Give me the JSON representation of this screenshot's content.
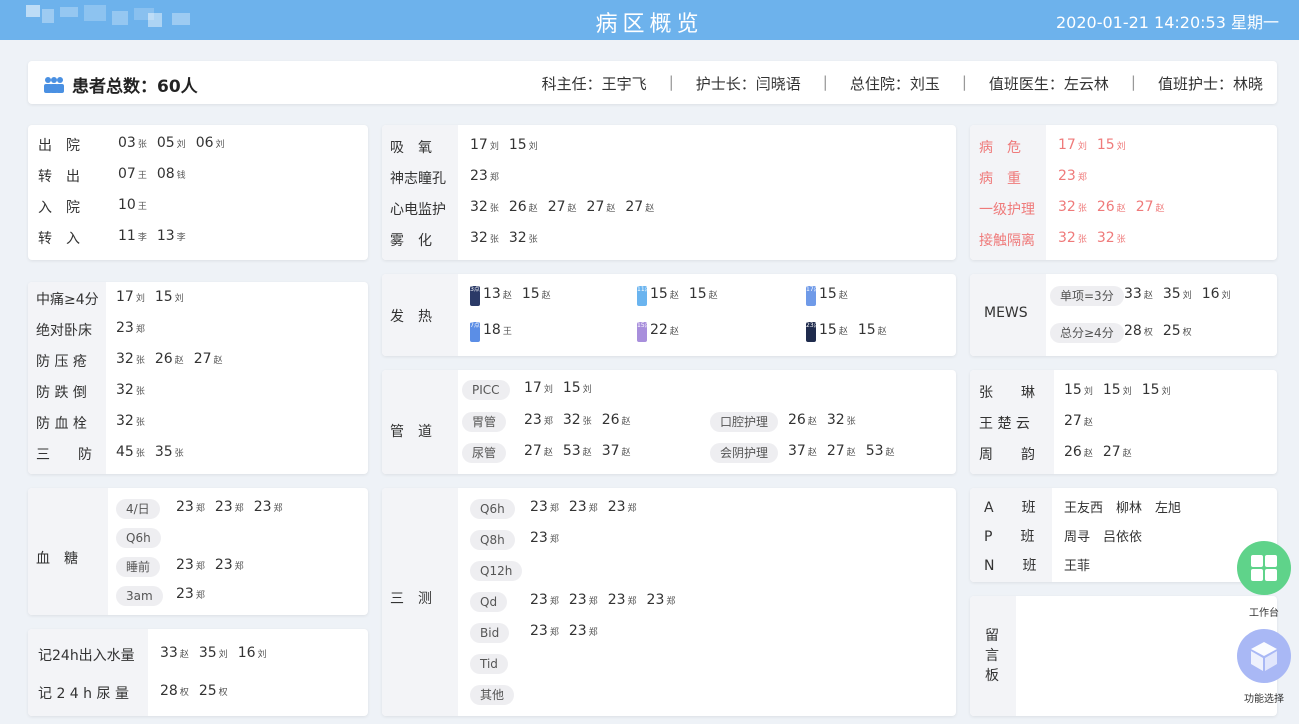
{
  "topbar": {
    "title": "病区概览",
    "datetime": "2020-01-21 14:20:53 星期一"
  },
  "header": {
    "patient_count": "患者总数：60人",
    "director": "科主任：王宇飞",
    "head_nurse": "护士长：闫晓语",
    "resident": "总住院：刘玉",
    "doctor": "值班医生：左云林",
    "nurse": "值班护士：林晓"
  },
  "movement": {
    "rows": [
      {
        "label": "出　院",
        "values": [
          [
            "03",
            "张"
          ],
          [
            "05",
            "刘"
          ],
          [
            "06",
            "刘"
          ]
        ]
      },
      {
        "label": "转　出",
        "values": [
          [
            "07",
            "王"
          ],
          [
            "08",
            "钱"
          ]
        ]
      },
      {
        "label": "入　院",
        "values": [
          [
            "10",
            "王"
          ]
        ]
      },
      {
        "label": "转　入",
        "values": [
          [
            "11",
            "李"
          ],
          [
            "13",
            "李"
          ]
        ]
      }
    ]
  },
  "care": {
    "rows": [
      {
        "label": "吸　氧",
        "values": [
          [
            "17",
            "刘"
          ],
          [
            "15",
            "刘"
          ]
        ]
      },
      {
        "label": "神志瞳孔",
        "values": [
          [
            "23",
            "郑"
          ]
        ]
      },
      {
        "label": "心电监护",
        "values": [
          [
            "32",
            "张"
          ],
          [
            "26",
            "赵"
          ],
          [
            "27",
            "赵"
          ],
          [
            "27",
            "赵"
          ],
          [
            "27",
            "赵"
          ]
        ]
      },
      {
        "label": "雾　化",
        "values": [
          [
            "32",
            "张"
          ],
          [
            "32",
            "张"
          ]
        ]
      }
    ]
  },
  "critical": {
    "rows": [
      {
        "label": "病　危",
        "values": [
          [
            "17",
            "刘"
          ],
          [
            "15",
            "刘"
          ]
        ]
      },
      {
        "label": "病　重",
        "values": [
          [
            "23",
            "郑"
          ]
        ]
      },
      {
        "label": "一级护理",
        "values": [
          [
            "32",
            "张"
          ],
          [
            "26",
            "赵"
          ],
          [
            "27",
            "赵"
          ]
        ]
      },
      {
        "label": "接触隔离",
        "values": [
          [
            "32",
            "张"
          ],
          [
            "32",
            "张"
          ]
        ]
      }
    ]
  },
  "risk": {
    "rows": [
      {
        "label": "中痛≥4分",
        "values": [
          [
            "17",
            "刘"
          ],
          [
            "15",
            "刘"
          ]
        ]
      },
      {
        "label": "绝对卧床",
        "values": [
          [
            "23",
            "郑"
          ]
        ]
      },
      {
        "label": "防 压 疮",
        "values": [
          [
            "32",
            "张"
          ],
          [
            "26",
            "赵"
          ],
          [
            "27",
            "赵"
          ]
        ]
      },
      {
        "label": "防 跌 倒",
        "values": [
          [
            "32",
            "张"
          ]
        ]
      },
      {
        "label": "防 血 栓",
        "values": [
          [
            "32",
            "张"
          ]
        ]
      },
      {
        "label": "三　　防",
        "values": [
          [
            "45",
            "张"
          ],
          [
            "35",
            "张"
          ]
        ]
      }
    ]
  },
  "fever": {
    "label": "发　热",
    "items": [
      {
        "badge": "3点",
        "color": "#2b3a67",
        "values": [
          [
            "13",
            "赵"
          ],
          [
            "15",
            "赵"
          ]
        ]
      },
      {
        "badge": "11点",
        "color": "#6ab4ef",
        "values": [
          [
            "15",
            "赵"
          ],
          [
            "15",
            "赵"
          ]
        ]
      },
      {
        "badge": "17点",
        "color": "#6f9ae8",
        "values": [
          [
            "15",
            "赵"
          ]
        ]
      },
      {
        "badge": "7点",
        "color": "#5b8ee6",
        "values": [
          [
            "18",
            "王"
          ]
        ]
      },
      {
        "badge": "15点",
        "color": "#a88fdc",
        "values": [
          [
            "22",
            "赵"
          ]
        ]
      },
      {
        "badge": "23点",
        "color": "#1f2b4d",
        "values": [
          [
            "15",
            "赵"
          ],
          [
            "15",
            "赵"
          ]
        ]
      }
    ]
  },
  "mews": {
    "label": "MEWS",
    "rows": [
      {
        "tag": "单项=3分",
        "values": [
          [
            "33",
            "赵"
          ],
          [
            "35",
            "刘"
          ],
          [
            "16",
            "刘"
          ]
        ]
      },
      {
        "tag": "总分≥4分",
        "values": [
          [
            "28",
            "权"
          ],
          [
            "25",
            "权"
          ]
        ]
      }
    ]
  },
  "tubes": {
    "label": "管　道",
    "items": [
      {
        "tag": "PICC",
        "values": [
          [
            "17",
            "刘"
          ],
          [
            "15",
            "刘"
          ]
        ]
      },
      {
        "tag": "胃管",
        "values": [
          [
            "23",
            "郑"
          ],
          [
            "32",
            "张"
          ],
          [
            "26",
            "赵"
          ]
        ]
      },
      {
        "tag": "口腔护理",
        "values": [
          [
            "26",
            "赵"
          ],
          [
            "32",
            "张"
          ]
        ]
      },
      {
        "tag": "尿管",
        "values": [
          [
            "27",
            "赵"
          ],
          [
            "53",
            "赵"
          ],
          [
            "37",
            "赵"
          ]
        ]
      },
      {
        "tag": "会阴护理",
        "values": [
          [
            "37",
            "赵"
          ],
          [
            "27",
            "赵"
          ],
          [
            "53",
            "赵"
          ]
        ]
      }
    ]
  },
  "nurses": {
    "rows": [
      {
        "label": "张　　琳",
        "values": [
          [
            "15",
            "刘"
          ],
          [
            "15",
            "刘"
          ],
          [
            "15",
            "刘"
          ]
        ]
      },
      {
        "label": "王 楚 云",
        "values": [
          [
            "27",
            "赵"
          ]
        ]
      },
      {
        "label": "周　　韵",
        "values": [
          [
            "26",
            "赵"
          ],
          [
            "27",
            "赵"
          ]
        ]
      }
    ]
  },
  "glucose": {
    "label": "血　糖",
    "rows": [
      {
        "tag": "4/日",
        "values": [
          [
            "23",
            "郑"
          ],
          [
            "23",
            "郑"
          ],
          [
            "23",
            "郑"
          ]
        ]
      },
      {
        "tag": "Q6h",
        "values": []
      },
      {
        "tag": "睡前",
        "values": [
          [
            "23",
            "郑"
          ],
          [
            "23",
            "郑"
          ]
        ]
      },
      {
        "tag": "3am",
        "values": [
          [
            "23",
            "郑"
          ]
        ]
      }
    ]
  },
  "vitals": {
    "label": "三　测",
    "rows": [
      {
        "tag": "Q6h",
        "values": [
          [
            "23",
            "郑"
          ],
          [
            "23",
            "郑"
          ],
          [
            "23",
            "郑"
          ]
        ]
      },
      {
        "tag": "Q8h",
        "values": [
          [
            "23",
            "郑"
          ]
        ]
      },
      {
        "tag": "Q12h",
        "values": []
      },
      {
        "tag": "Qd",
        "values": [
          [
            "23",
            "郑"
          ],
          [
            "23",
            "郑"
          ],
          [
            "23",
            "郑"
          ],
          [
            "23",
            "郑"
          ]
        ]
      },
      {
        "tag": "Bid",
        "values": [
          [
            "23",
            "郑"
          ],
          [
            "23",
            "郑"
          ]
        ]
      },
      {
        "tag": "Tid",
        "values": []
      },
      {
        "tag": "其他",
        "values": []
      }
    ]
  },
  "shifts": {
    "rows": [
      {
        "label": "A　　班",
        "names": "王友西　柳林　左旭"
      },
      {
        "label": "P　　班",
        "names": "周寻　吕依依"
      },
      {
        "label": "N　　班",
        "names": "王菲"
      }
    ]
  },
  "io": {
    "rows": [
      {
        "label": "记24h出入水量",
        "values": [
          [
            "33",
            "赵"
          ],
          [
            "35",
            "刘"
          ],
          [
            "16",
            "刘"
          ]
        ]
      },
      {
        "label": "记 2 4 h 尿 量",
        "values": [
          [
            "28",
            "权"
          ],
          [
            "25",
            "权"
          ]
        ]
      }
    ]
  },
  "message_board": {
    "label": "留言板"
  },
  "fab": {
    "workbench": {
      "label": "工作台",
      "color": "#5fd38a",
      "icon": "grid-icon"
    },
    "function": {
      "label": "功能选择",
      "color": "#a9b8f5",
      "icon": "cube-icon"
    }
  }
}
